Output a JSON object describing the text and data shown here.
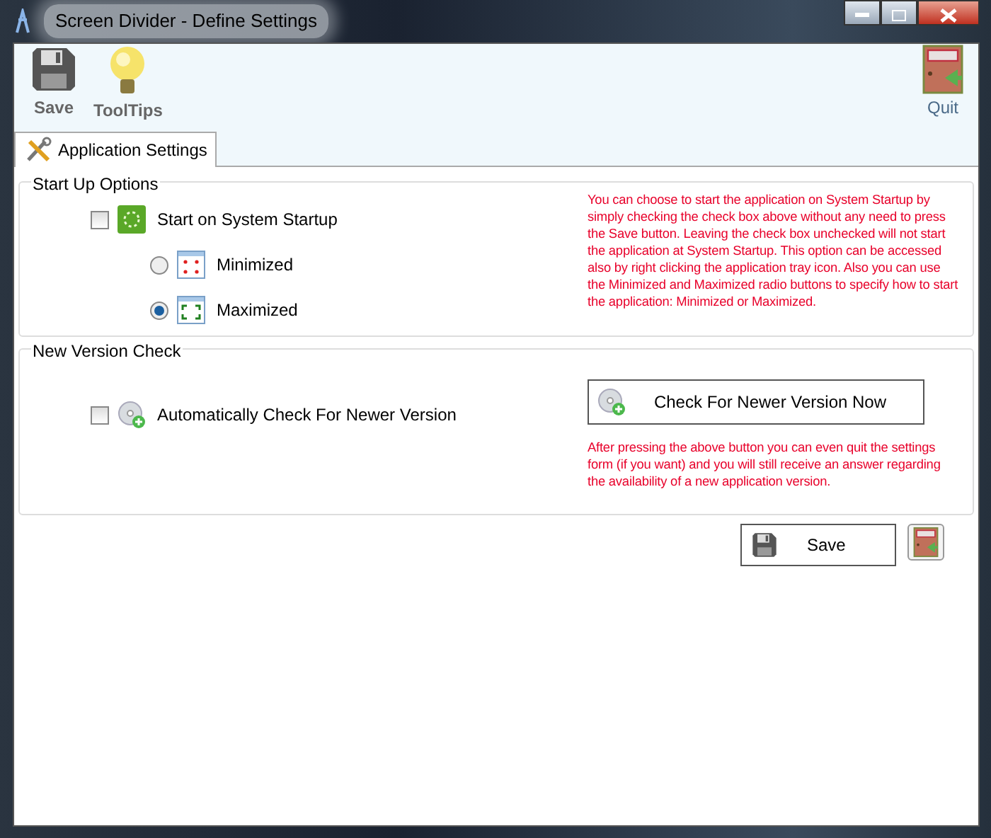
{
  "window": {
    "title": "Screen Divider - Define Settings"
  },
  "toolbar": {
    "buttons": [
      {
        "label": "Save",
        "kind": "save"
      },
      {
        "label": "ToolTips",
        "kind": "tips"
      },
      {
        "label": "Quit",
        "kind": "quit"
      }
    ]
  },
  "tabs": [
    {
      "label": "Application Settings",
      "selected": true
    }
  ],
  "startup": {
    "title": "Start Up Options",
    "start_on_startup": {
      "label": "Start on System Startup",
      "checked": false
    },
    "modes": [
      {
        "label": "Minimized",
        "selected": false,
        "kind": "minimized"
      },
      {
        "label": "Maximized",
        "selected": true,
        "kind": "maximized"
      }
    ],
    "help": "You can choose to start the application on System Startup by simply checking the check box above without any need to press the Save button. Leaving the check box unchecked will not start the application at System Startup. This option can be accessed also by right clicking the application tray icon. Also you can use the Minimized and Maximized radio buttons to specify how to start the application: Minimized or Maximized."
  },
  "version_check": {
    "title": "New Version Check",
    "auto_check": {
      "label": "Automatically Check For Newer Version",
      "checked": false
    },
    "check_button": "Check For Newer Version Now",
    "help": "After pressing the above button you can even quit the settings form (if you want) and you will still receive an answer regarding the availability of a new application version."
  },
  "footer": {
    "save_button": "Save"
  }
}
